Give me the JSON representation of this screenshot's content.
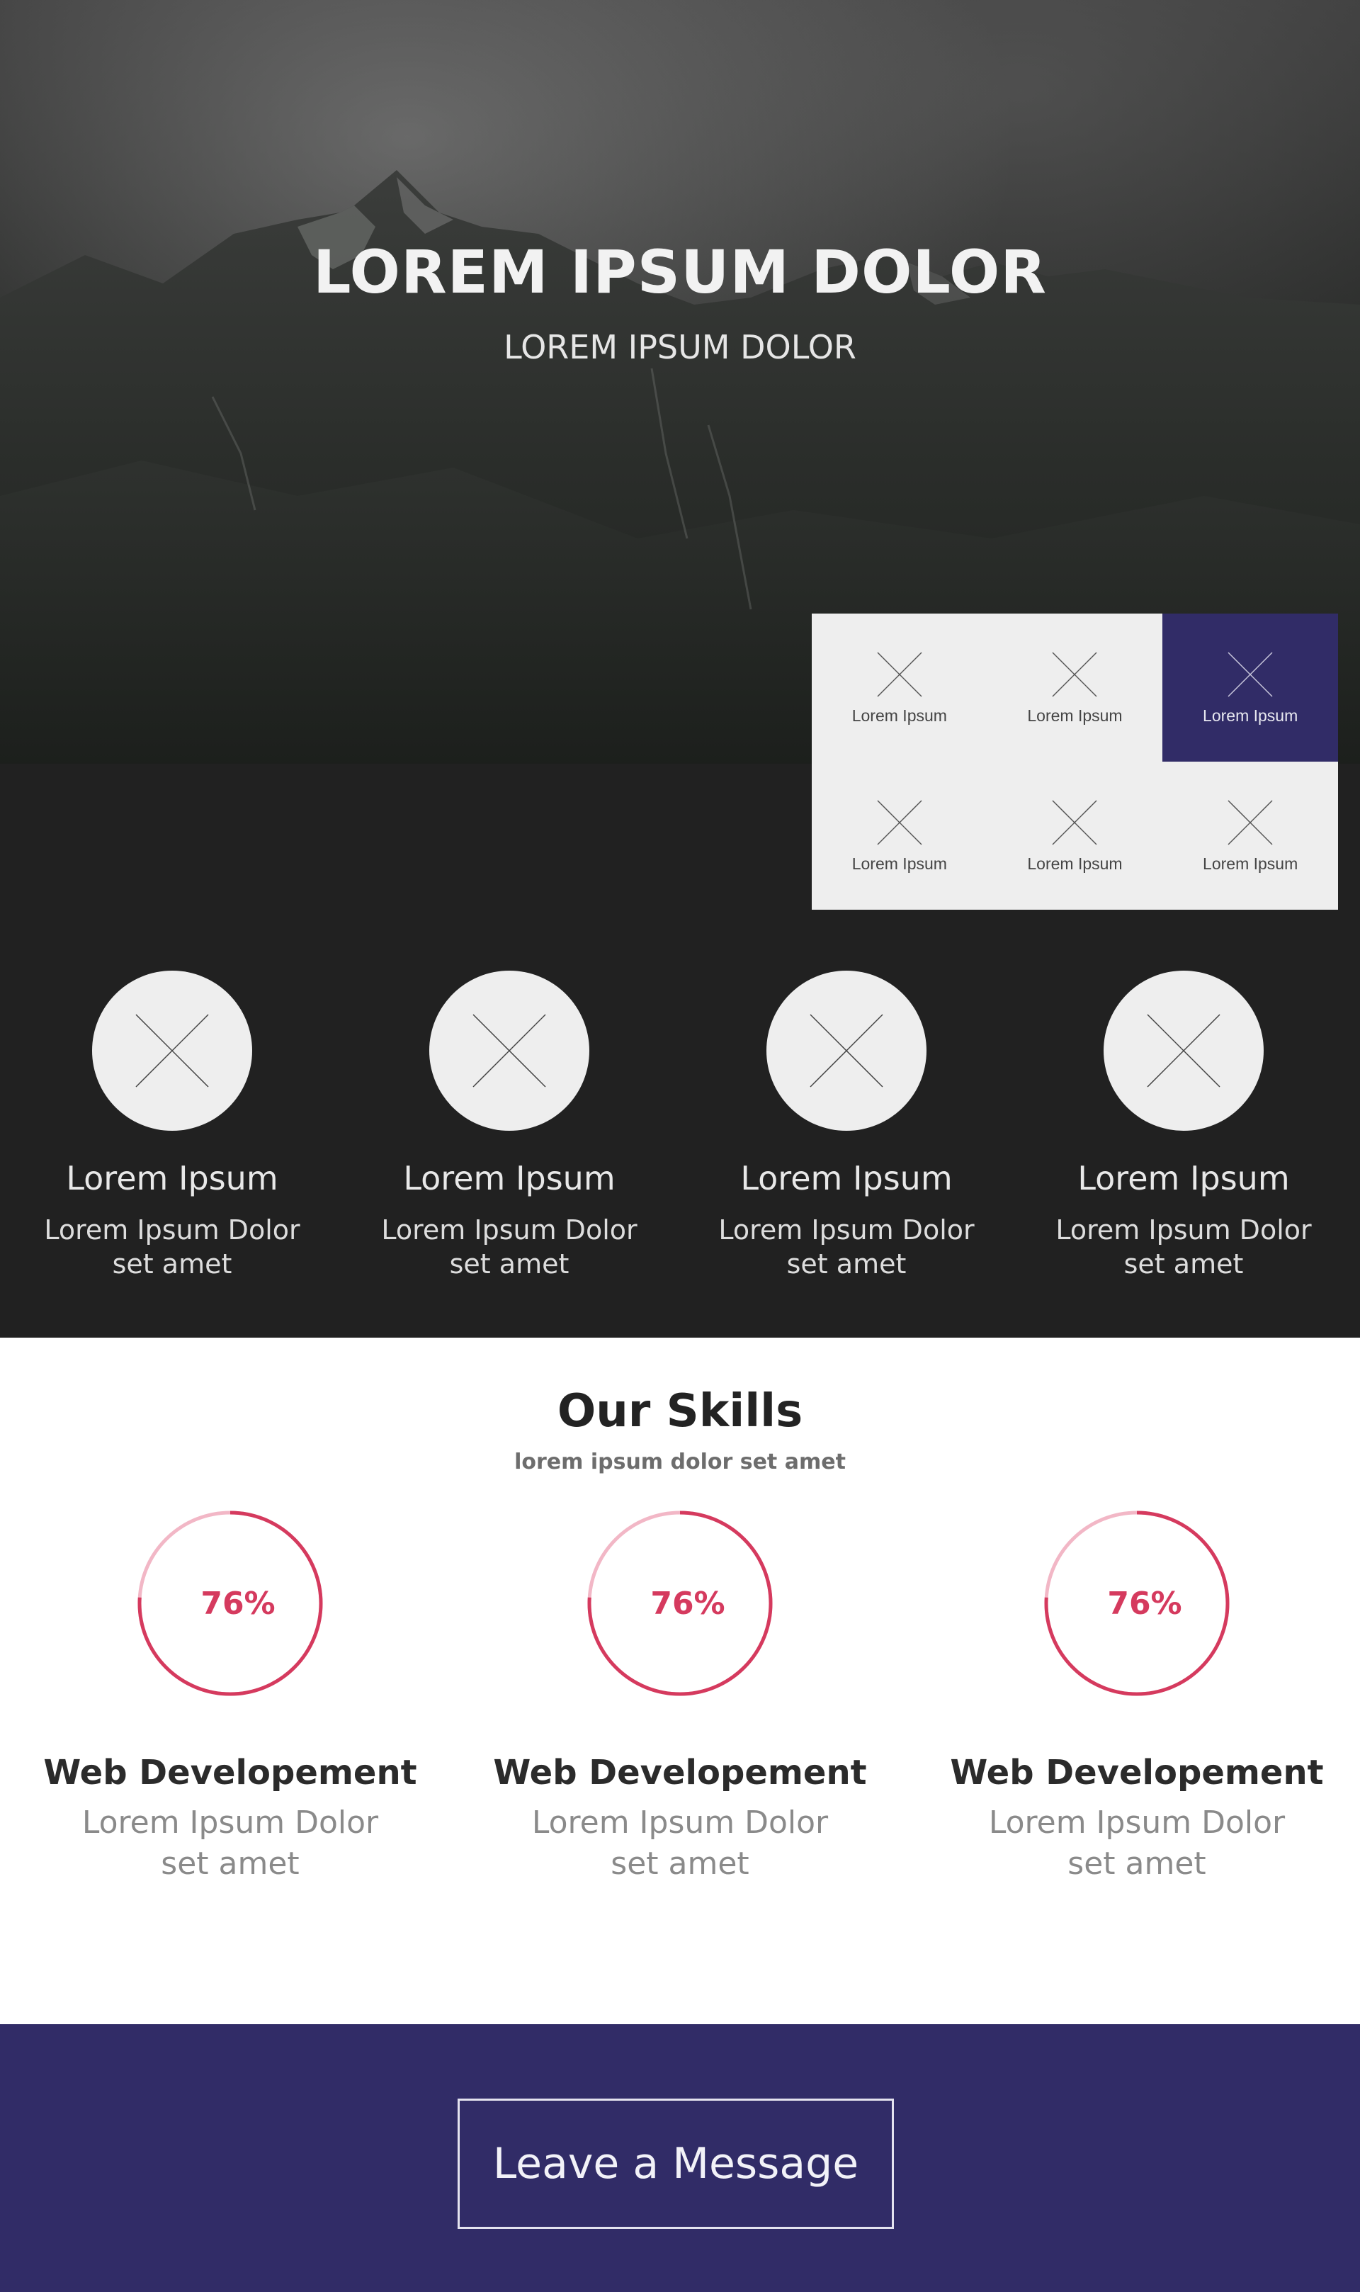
{
  "hero": {
    "title": "LOREM IPSUM DOLOR",
    "subtitle": "LOREM IPSUM DOLOR"
  },
  "grid": {
    "accent": "#312c67",
    "items": [
      {
        "label": "Lorem Ipsum",
        "icon": "placeholder-x-icon",
        "active": false
      },
      {
        "label": "Lorem Ipsum",
        "icon": "placeholder-x-icon",
        "active": false
      },
      {
        "label": "Lorem Ipsum",
        "icon": "placeholder-x-icon",
        "active": true
      },
      {
        "label": "Lorem Ipsum",
        "icon": "placeholder-x-icon",
        "active": false
      },
      {
        "label": "Lorem Ipsum",
        "icon": "placeholder-x-icon",
        "active": false
      },
      {
        "label": "Lorem Ipsum",
        "icon": "placeholder-x-icon",
        "active": false
      }
    ]
  },
  "features": [
    {
      "title": "Lorem Ipsum",
      "desc_line1": "Lorem Ipsum Dolor",
      "desc_line2": "set amet"
    },
    {
      "title": "Lorem Ipsum",
      "desc_line1": "Lorem Ipsum Dolor",
      "desc_line2": "set amet"
    },
    {
      "title": "Lorem Ipsum",
      "desc_line1": "Lorem Ipsum Dolor",
      "desc_line2": "set amet"
    },
    {
      "title": "Lorem Ipsum",
      "desc_line1": "Lorem Ipsum Dolor",
      "desc_line2": "set amet"
    }
  ],
  "skills": {
    "title": "Our Skills",
    "subtitle": "lorem ipsum dolor set amet",
    "accent": "#d53a5e",
    "track": "#f2b7c6",
    "items": [
      {
        "percent_label": "76%",
        "percent": 76,
        "title": "Web Developement",
        "desc_line1": "Lorem Ipsum Dolor",
        "desc_line2": "set amet"
      },
      {
        "percent_label": "76%",
        "percent": 76,
        "title": "Web Developement",
        "desc_line1": "Lorem Ipsum Dolor",
        "desc_line2": "set amet"
      },
      {
        "percent_label": "76%",
        "percent": 76,
        "title": "Web Developement",
        "desc_line1": "Lorem Ipsum Dolor",
        "desc_line2": "set amet"
      }
    ]
  },
  "footer": {
    "button_label": "Leave a Message",
    "background": "#312c67"
  }
}
